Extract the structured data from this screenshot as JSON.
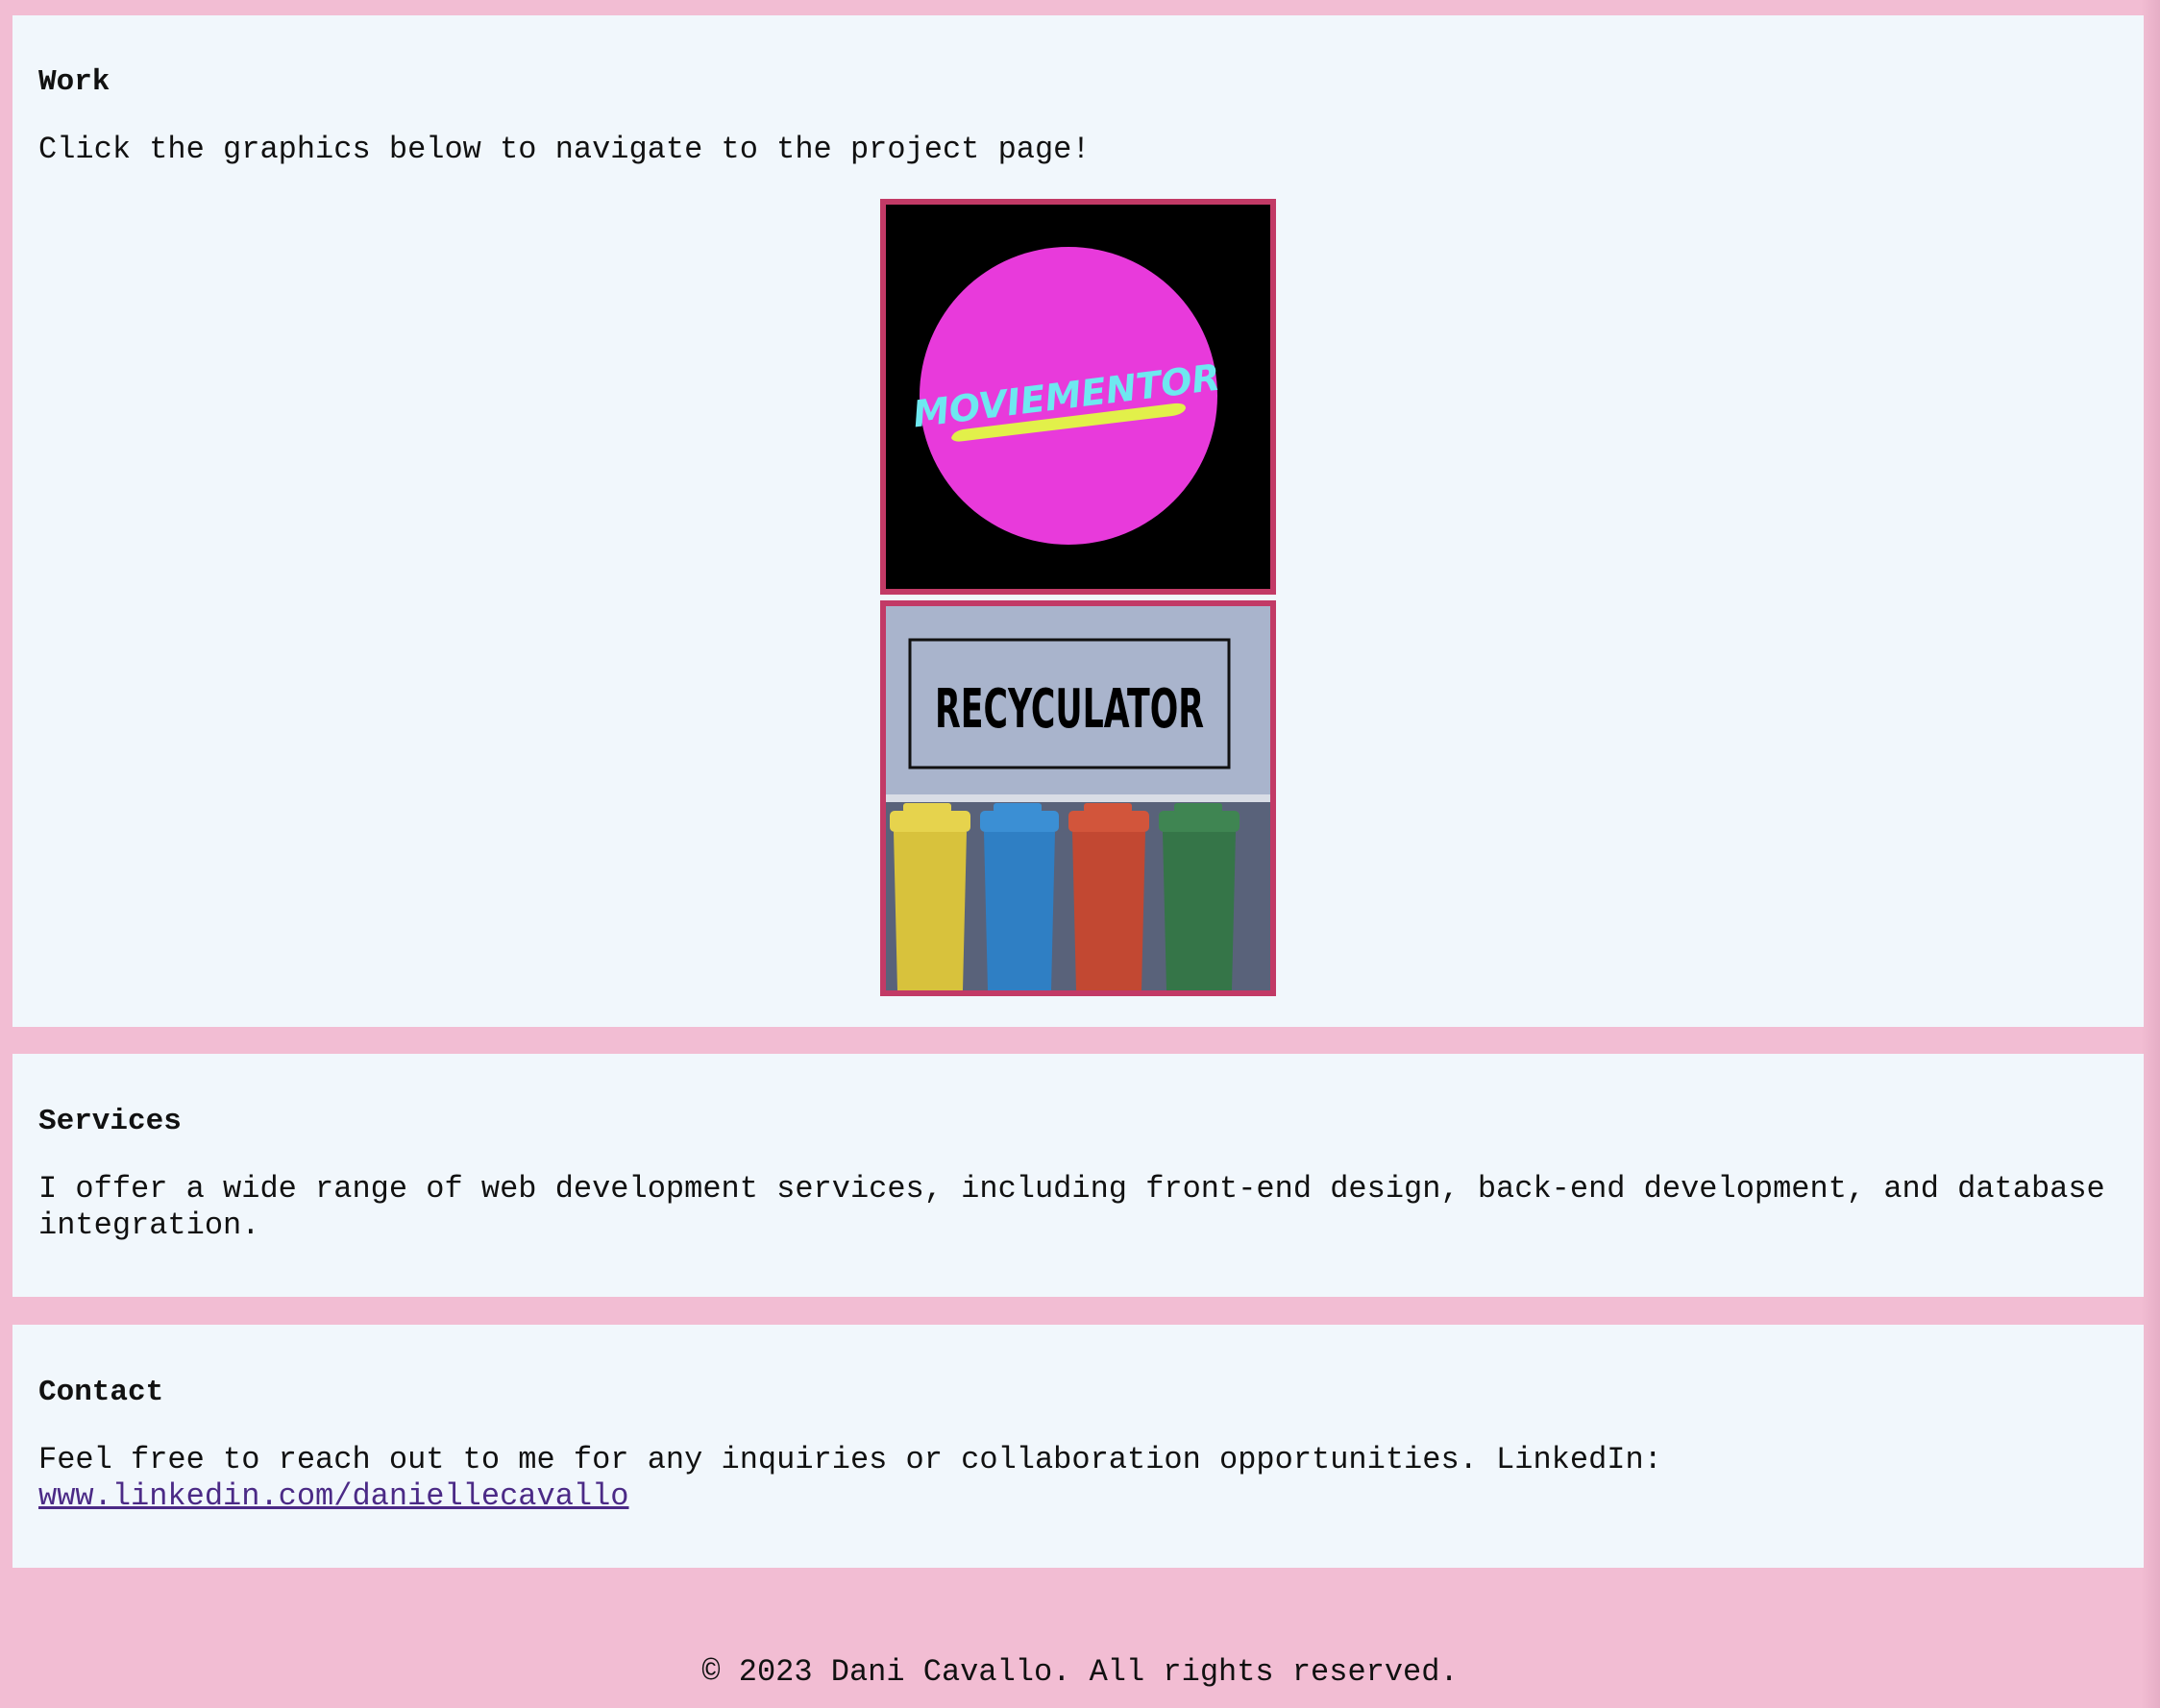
{
  "work": {
    "heading": "Work",
    "intro": "Click the graphics below to navigate to the project page!",
    "projects": [
      {
        "name": "MOVIEMENTOR",
        "colors": {
          "background": "#000000",
          "circle": "#e83adb",
          "text": "#6ee8f0",
          "swoosh": "#e2f04a"
        }
      },
      {
        "name": "RECYCULATOR",
        "colors": {
          "wall": "#a9b4cc",
          "bins": [
            "#e6d34d",
            "#3b8fd4",
            "#d2553b",
            "#3f8552"
          ]
        }
      }
    ]
  },
  "services": {
    "heading": "Services",
    "text": "I offer a wide range of web development services, including front-end design, back-end development, and database integration."
  },
  "contact": {
    "heading": "Contact",
    "text": "Feel free to reach out to me for any inquiries or collaboration opportunities. LinkedIn:",
    "link_text": "www.linkedin.com/daniellecavallo"
  },
  "footer": {
    "text": "© 2023 Dani Cavallo. All rights reserved."
  },
  "colors": {
    "page_background": "#f2bdd3",
    "panel_background": "#f1f7fc",
    "tile_border": "#c23a66",
    "link": "#4b2a86"
  }
}
